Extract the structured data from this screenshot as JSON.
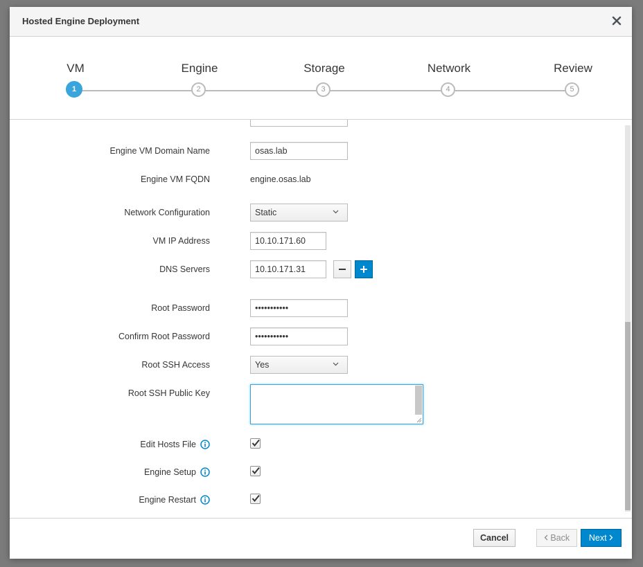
{
  "dialog": {
    "title": "Hosted Engine Deployment"
  },
  "steps": [
    {
      "label": "VM",
      "number": "1",
      "active": true
    },
    {
      "label": "Engine",
      "number": "2",
      "active": false
    },
    {
      "label": "Storage",
      "number": "3",
      "active": false
    },
    {
      "label": "Network",
      "number": "4",
      "active": false
    },
    {
      "label": "Review",
      "number": "5",
      "active": false
    }
  ],
  "form": {
    "engine_vm_domain_name": {
      "label": "Engine VM Domain Name",
      "value": "osas.lab"
    },
    "engine_vm_fqdn": {
      "label": "Engine VM FQDN",
      "value": "engine.osas.lab"
    },
    "network_configuration": {
      "label": "Network Configuration",
      "value": "Static"
    },
    "vm_ip_address": {
      "label": "VM IP Address",
      "value": "10.10.171.60"
    },
    "dns_servers": {
      "label": "DNS Servers",
      "value": "10.10.171.31"
    },
    "root_password": {
      "label": "Root Password",
      "value": "•••••••••••"
    },
    "confirm_root_password": {
      "label": "Confirm Root Password",
      "value": "•••••••••••"
    },
    "root_ssh_access": {
      "label": "Root SSH Access",
      "value": "Yes"
    },
    "root_ssh_public_key": {
      "label": "Root SSH Public Key",
      "value": ""
    },
    "edit_hosts_file": {
      "label": "Edit Hosts File",
      "checked": true
    },
    "engine_setup": {
      "label": "Engine Setup",
      "checked": true
    },
    "engine_restart": {
      "label": "Engine Restart",
      "checked": true
    }
  },
  "footer": {
    "cancel_label": "Cancel",
    "back_label": "Back",
    "next_label": "Next"
  },
  "colors": {
    "accent": "#0088ce",
    "active_step": "#39a5dc",
    "overlay": "#7b7b7b"
  }
}
